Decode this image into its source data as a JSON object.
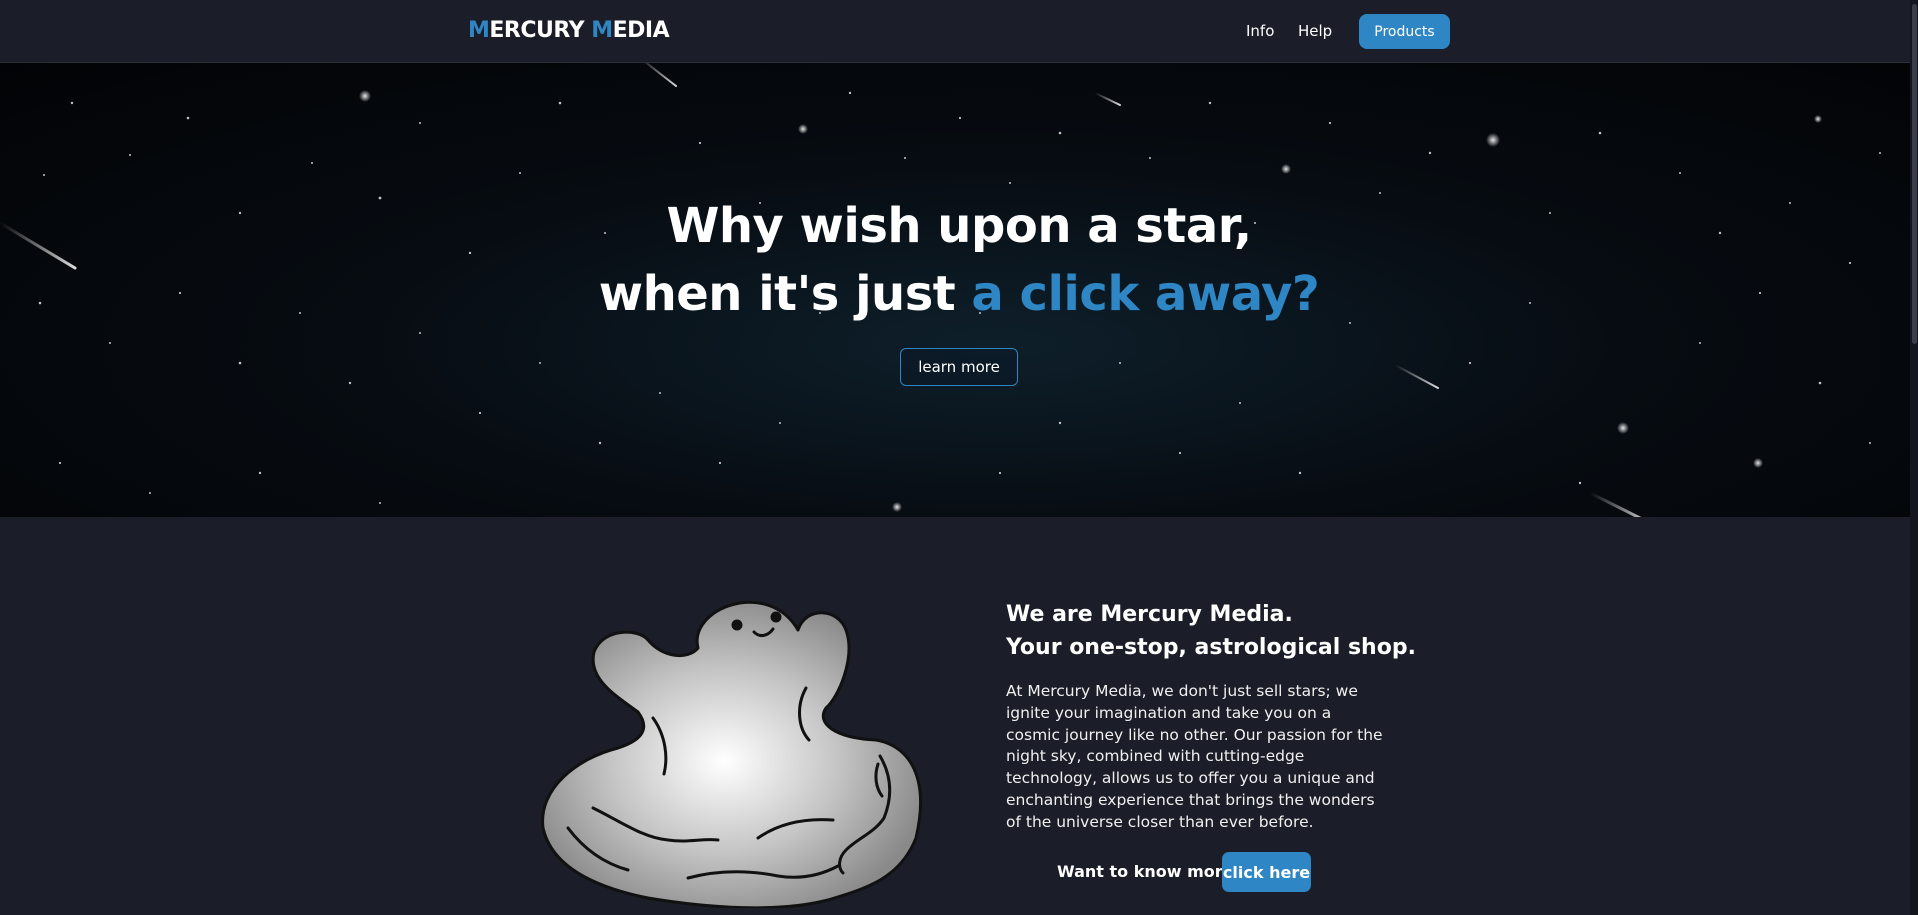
{
  "nav": {
    "logo_first_initial": "M",
    "logo_first_rest": "ERCURY ",
    "logo_second_initial": "M",
    "logo_second_rest": "EDIA",
    "links": [
      "Info",
      "Help"
    ],
    "cta": "Products"
  },
  "hero": {
    "line1": "Why wish upon a star,",
    "line2_prefix": "when it's just ",
    "line2_highlight": "a click away?",
    "button": "learn more"
  },
  "about": {
    "heading_line1": "We are Mercury Media.",
    "heading_line2": "Your one-stop, astrological shop.",
    "body": "At Mercury Media, we don't just sell stars; we ignite your imagination and take you on a cosmic journey like no other. Our passion for the night sky, combined with cutting-edge technology, allows us to offer you a unique and enchanting experience that brings the wonders of the universe closer than ever before.",
    "cta_label": "Want to know more?",
    "cta_button": "click here"
  },
  "icons": {
    "mascot": "ghost-mascot-icon"
  },
  "colors": {
    "accent": "#2f86c4",
    "background": "#1b1d28",
    "hero_background": "#04070b"
  }
}
